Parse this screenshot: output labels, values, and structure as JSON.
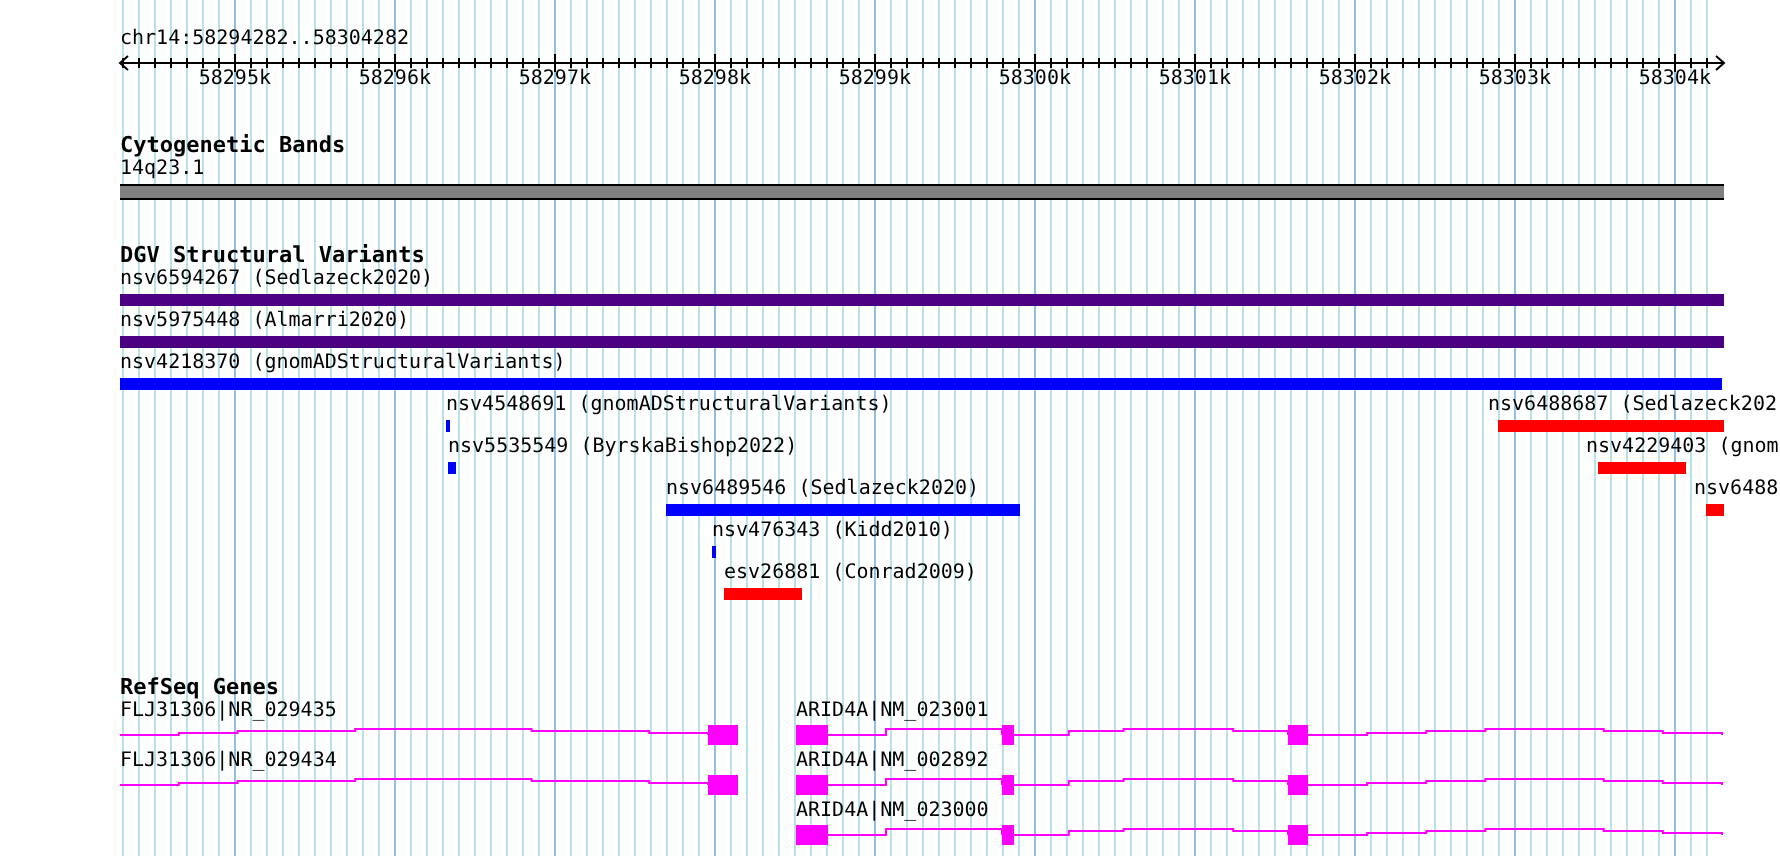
{
  "ruler": {
    "location": "chr14:58294282..58304282",
    "ticks": [
      "58295k",
      "58296k",
      "58297k",
      "58298k",
      "58299k",
      "58300k",
      "58301k",
      "58302k",
      "58303k",
      "58304k"
    ]
  },
  "tracks": [
    {
      "title": "Cytogenetic Bands",
      "kind": "band",
      "features": [
        {
          "label": "14q23.1"
        }
      ]
    },
    {
      "title": "DGV Structural Variants",
      "kind": "variant",
      "features": [
        {
          "label": "nsv6594267 (Sedlazeck2020)",
          "color": "#4b0082"
        },
        {
          "label": "nsv5975448 (Almarri2020)",
          "color": "#4b0082"
        },
        {
          "label": "nsv4218370 (gnomADStructuralVariants)",
          "color": "#0000ff"
        },
        {
          "label": "nsv4548691 (gnomADStructuralVariants)",
          "color": "#0000ff"
        },
        {
          "label": "nsv6488687 (Sedlazeck202",
          "color": "#ff0000"
        },
        {
          "label": "nsv5535549 (ByrskaBishop2022)",
          "color": "#0000ff"
        },
        {
          "label": "nsv4229403 (gnom",
          "color": "#ff0000"
        },
        {
          "label": "nsv6489546 (Sedlazeck2020)",
          "color": "#0000ff"
        },
        {
          "label": "nsv6488",
          "color": "#ff0000"
        },
        {
          "label": "nsv476343 (Kidd2010)",
          "color": "#0000ff"
        },
        {
          "label": "esv26881 (Conrad2009)",
          "color": "#ff0000"
        }
      ]
    },
    {
      "title": "RefSeq Genes",
      "kind": "gene",
      "features": [
        {
          "label": "FLJ31306|NR_029435"
        },
        {
          "label": "ARID4A|NM_023001"
        },
        {
          "label": "FLJ31306|NR_029434"
        },
        {
          "label": "ARID4A|NM_002892"
        },
        {
          "label": "ARID4A|NM_023000"
        }
      ]
    }
  ]
}
